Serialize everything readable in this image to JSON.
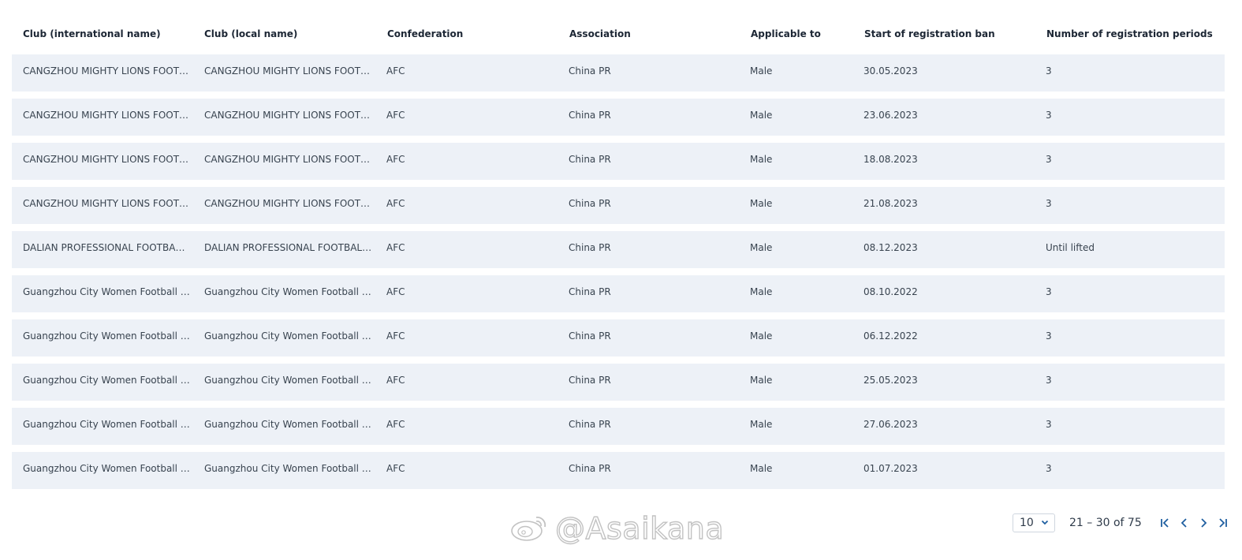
{
  "table": {
    "headers": [
      "Club (international name)",
      "Club (local name)",
      "Confederation",
      "Association",
      "Applicable to",
      "Start of registration ban",
      "Number of registration periods"
    ],
    "rows": [
      [
        "CANGZHOU MIGHTY LIONS FOOTB...",
        "CANGZHOU MIGHTY LIONS FOOTB...",
        "AFC",
        "China PR",
        "Male",
        "30.05.2023",
        "3"
      ],
      [
        "CANGZHOU MIGHTY LIONS FOOTB...",
        "CANGZHOU MIGHTY LIONS FOOTB...",
        "AFC",
        "China PR",
        "Male",
        "23.06.2023",
        "3"
      ],
      [
        "CANGZHOU MIGHTY LIONS FOOTB...",
        "CANGZHOU MIGHTY LIONS FOOTB...",
        "AFC",
        "China PR",
        "Male",
        "18.08.2023",
        "3"
      ],
      [
        "CANGZHOU MIGHTY LIONS FOOTB...",
        "CANGZHOU MIGHTY LIONS FOOTB...",
        "AFC",
        "China PR",
        "Male",
        "21.08.2023",
        "3"
      ],
      [
        "DALIAN PROFESSIONAL FOOTBALL ...",
        "DALIAN PROFESSIONAL FOOTBALL ...",
        "AFC",
        "China PR",
        "Male",
        "08.12.2023",
        "Until lifted"
      ],
      [
        "Guangzhou City Women Football Cl...",
        "Guangzhou City Women Football Cl...",
        "AFC",
        "China PR",
        "Male",
        "08.10.2022",
        "3"
      ],
      [
        "Guangzhou City Women Football Cl...",
        "Guangzhou City Women Football Cl...",
        "AFC",
        "China PR",
        "Male",
        "06.12.2022",
        "3"
      ],
      [
        "Guangzhou City Women Football Cl...",
        "Guangzhou City Women Football Cl...",
        "AFC",
        "China PR",
        "Male",
        "25.05.2023",
        "3"
      ],
      [
        "Guangzhou City Women Football Cl...",
        "Guangzhou City Women Football Cl...",
        "AFC",
        "China PR",
        "Male",
        "27.06.2023",
        "3"
      ],
      [
        "Guangzhou City Women Football Cl...",
        "Guangzhou City Women Football Cl...",
        "AFC",
        "China PR",
        "Male",
        "01.07.2023",
        "3"
      ]
    ]
  },
  "pagination": {
    "page_size": "10",
    "range_label": "21 – 30 of 75",
    "icons": [
      "first-page-icon",
      "previous-page-icon",
      "next-page-icon",
      "last-page-icon"
    ]
  },
  "watermark": {
    "text": "@Asaikana",
    "icon": "weibo-logo-icon"
  },
  "colors": {
    "row_background": "#edf1f7",
    "nav_icon": "#1f5fa0"
  }
}
